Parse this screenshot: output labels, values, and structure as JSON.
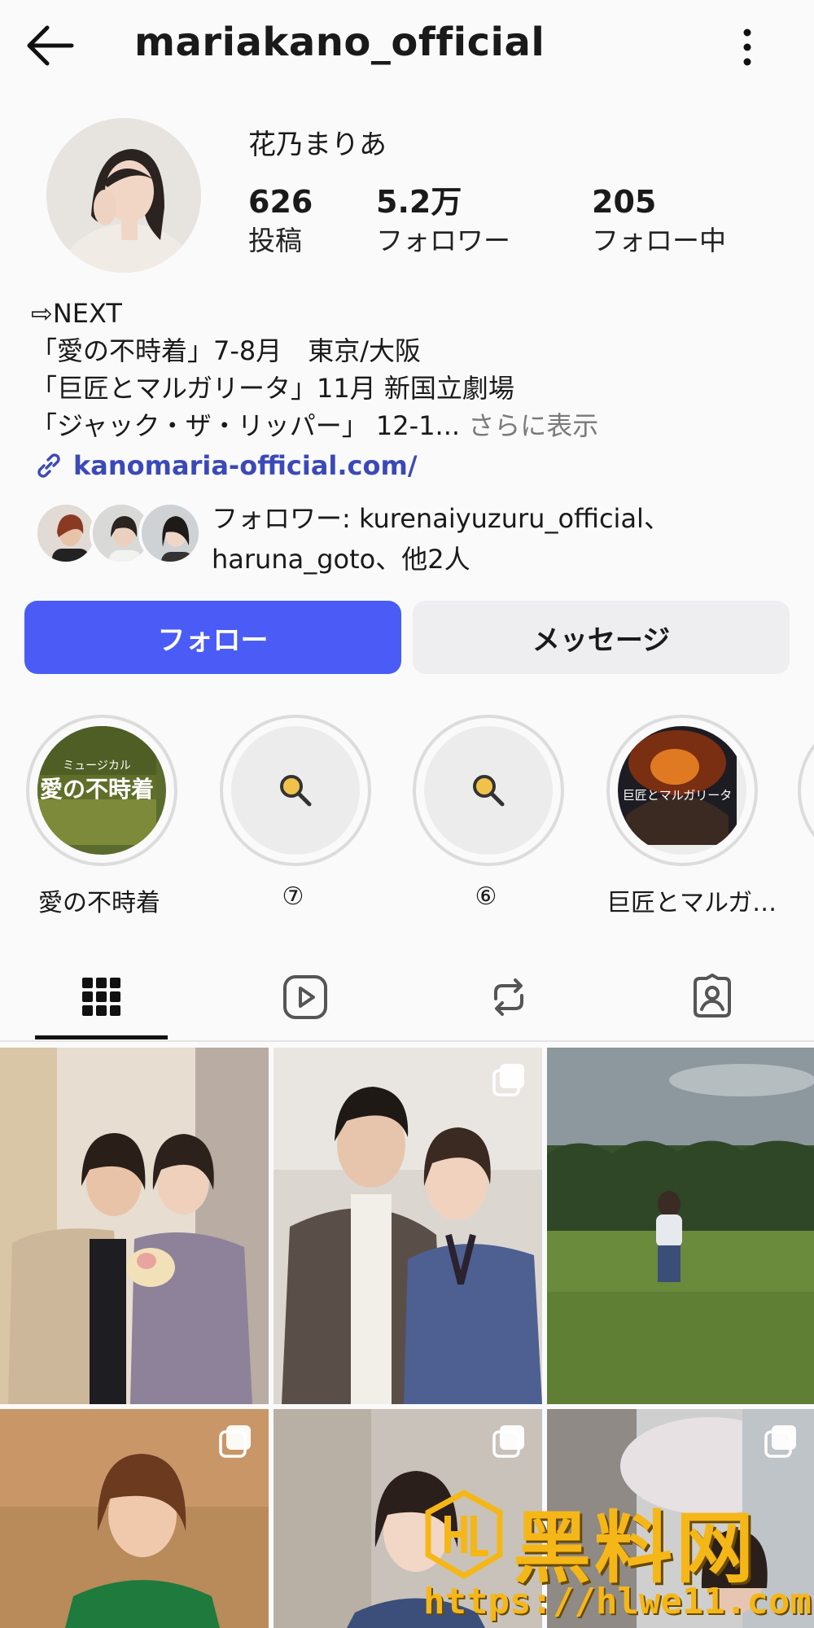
{
  "header": {
    "title": "mariakano_official"
  },
  "profile": {
    "display_name": "花乃まりあ",
    "stats": [
      {
        "value": "626",
        "label": "投稿"
      },
      {
        "value": "5.2万",
        "label": "フォロワー"
      },
      {
        "value": "205",
        "label": "フォロー中"
      }
    ],
    "bio_lines": [
      "⇨NEXT",
      "「愛の不時着」7-8月　東京/大阪",
      "「巨匠とマルガリータ」11月 新国立劇場",
      "「ジャック・ザ・リッパー」 12-1..."
    ],
    "bio_more": "さらに表示",
    "link": "kanomaria-official.com/",
    "followed_by_line1": "フォロワー: kurenaiyuzuru_official、",
    "followed_by_line2": "haruna_goto、他2人"
  },
  "actions": {
    "follow": "フォロー",
    "message": "メッセージ"
  },
  "highlights": [
    {
      "label": "愛の不時着",
      "cover_text": "愛の不時着",
      "cover_sub": "ミュージカル"
    },
    {
      "label": "⑦"
    },
    {
      "label": "⑥"
    },
    {
      "label": "巨匠とマルガ…",
      "cover_text": "巨匠とマルガリータ"
    }
  ],
  "tabs": [
    {
      "icon": "grid-icon",
      "selected": true
    },
    {
      "icon": "reels-icon",
      "selected": false
    },
    {
      "icon": "reposts-icon",
      "selected": false
    },
    {
      "icon": "tagged-icon",
      "selected": false
    }
  ],
  "watermark": {
    "brand": "黑料网",
    "url": "https://hlwe11.com"
  },
  "colors": {
    "accent": "#4a5cf5",
    "link": "#3b49b8",
    "watermark": "#f5b718"
  }
}
